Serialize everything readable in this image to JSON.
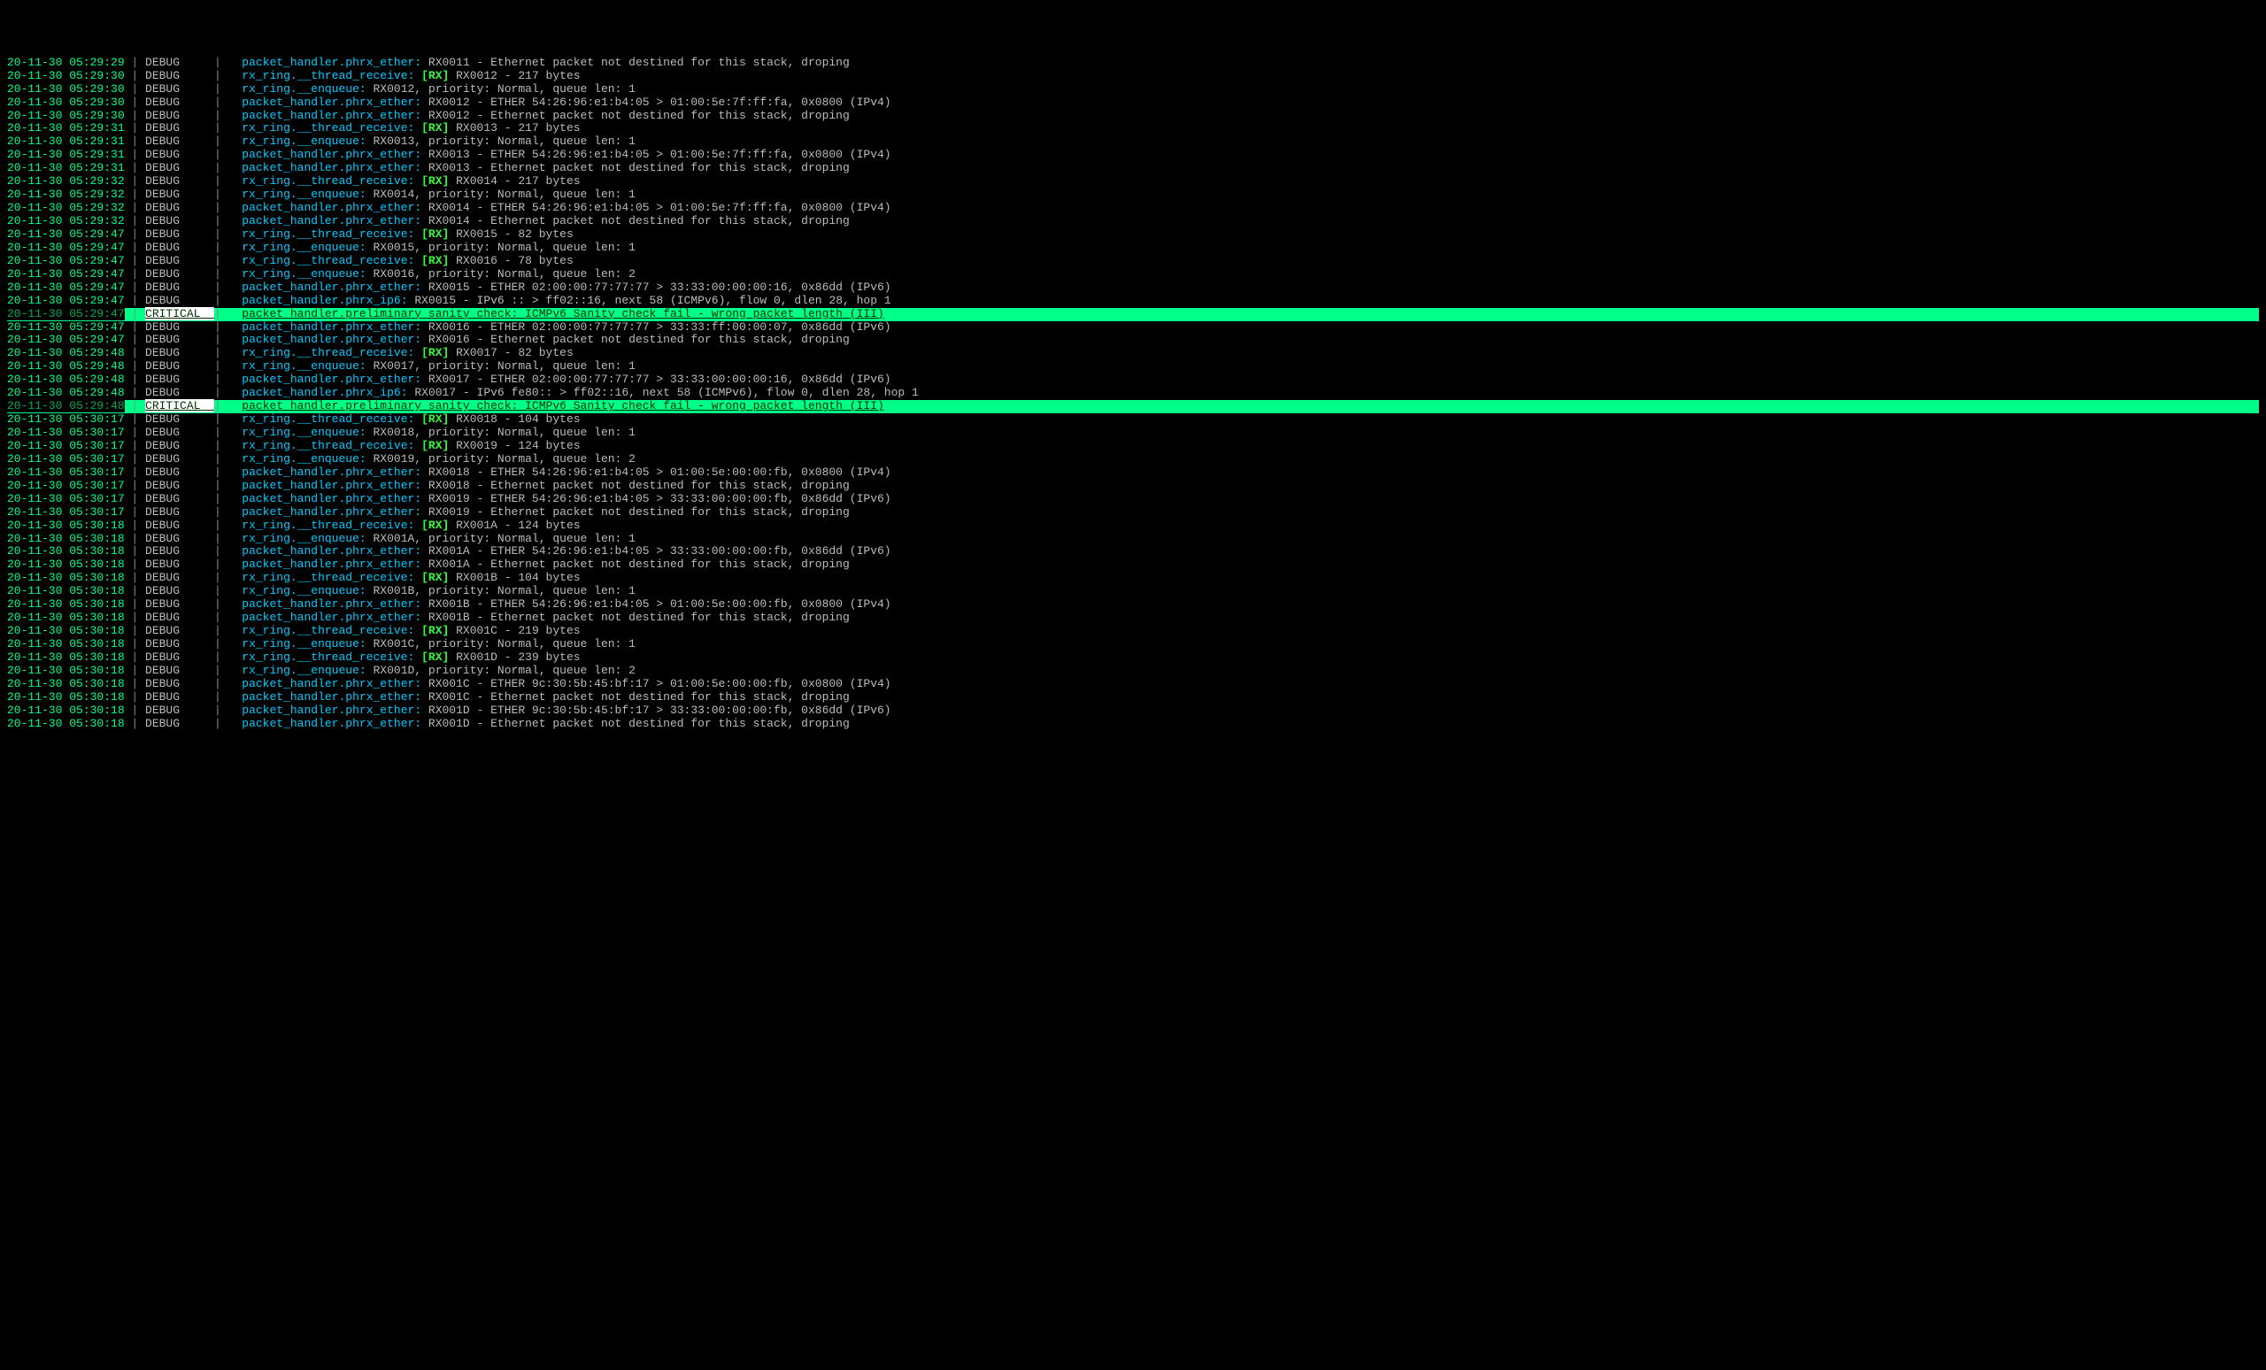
{
  "colors": {
    "timestamp": "#00ff88",
    "pipe": "#888888",
    "level_debug": "#bbbbbb",
    "logger": "#00ccff",
    "rx_tag": "#33ff33",
    "message": "#bbbbbb",
    "critical_bg": "#00ff88",
    "critical_fg": "#003300"
  },
  "columns": {
    "level_width_chars": 10
  },
  "log_lines": [
    {
      "ts": "20-11-30 05:29:29",
      "level": "DEBUG",
      "logger": "packet_handler.phrx_ether:",
      "msg": "RX0011 - Ethernet packet not destined for this stack, droping"
    },
    {
      "ts": "20-11-30 05:29:30",
      "level": "DEBUG",
      "logger": "rx_ring.__thread_receive:",
      "rx": "[RX]",
      "msg": " RX0012 - 217 bytes"
    },
    {
      "ts": "20-11-30 05:29:30",
      "level": "DEBUG",
      "logger": "rx_ring.__enqueue:",
      "msg": "RX0012, priority: Normal, queue len: 1"
    },
    {
      "ts": "20-11-30 05:29:30",
      "level": "DEBUG",
      "logger": "packet_handler.phrx_ether:",
      "msg": "RX0012 - ETHER 54:26:96:e1:b4:05 > 01:00:5e:7f:ff:fa, 0x0800 (IPv4)"
    },
    {
      "ts": "20-11-30 05:29:30",
      "level": "DEBUG",
      "logger": "packet_handler.phrx_ether:",
      "msg": "RX0012 - Ethernet packet not destined for this stack, droping"
    },
    {
      "ts": "20-11-30 05:29:31",
      "level": "DEBUG",
      "logger": "rx_ring.__thread_receive:",
      "rx": "[RX]",
      "msg": " RX0013 - 217 bytes"
    },
    {
      "ts": "20-11-30 05:29:31",
      "level": "DEBUG",
      "logger": "rx_ring.__enqueue:",
      "msg": "RX0013, priority: Normal, queue len: 1"
    },
    {
      "ts": "20-11-30 05:29:31",
      "level": "DEBUG",
      "logger": "packet_handler.phrx_ether:",
      "msg": "RX0013 - ETHER 54:26:96:e1:b4:05 > 01:00:5e:7f:ff:fa, 0x0800 (IPv4)"
    },
    {
      "ts": "20-11-30 05:29:31",
      "level": "DEBUG",
      "logger": "packet_handler.phrx_ether:",
      "msg": "RX0013 - Ethernet packet not destined for this stack, droping"
    },
    {
      "ts": "20-11-30 05:29:32",
      "level": "DEBUG",
      "logger": "rx_ring.__thread_receive:",
      "rx": "[RX]",
      "msg": " RX0014 - 217 bytes"
    },
    {
      "ts": "20-11-30 05:29:32",
      "level": "DEBUG",
      "logger": "rx_ring.__enqueue:",
      "msg": "RX0014, priority: Normal, queue len: 1"
    },
    {
      "ts": "20-11-30 05:29:32",
      "level": "DEBUG",
      "logger": "packet_handler.phrx_ether:",
      "msg": "RX0014 - ETHER 54:26:96:e1:b4:05 > 01:00:5e:7f:ff:fa, 0x0800 (IPv4)"
    },
    {
      "ts": "20-11-30 05:29:32",
      "level": "DEBUG",
      "logger": "packet_handler.phrx_ether:",
      "msg": "RX0014 - Ethernet packet not destined for this stack, droping"
    },
    {
      "ts": "20-11-30 05:29:47",
      "level": "DEBUG",
      "logger": "rx_ring.__thread_receive:",
      "rx": "[RX]",
      "msg": " RX0015 - 82 bytes"
    },
    {
      "ts": "20-11-30 05:29:47",
      "level": "DEBUG",
      "logger": "rx_ring.__enqueue:",
      "msg": "RX0015, priority: Normal, queue len: 1"
    },
    {
      "ts": "20-11-30 05:29:47",
      "level": "DEBUG",
      "logger": "rx_ring.__thread_receive:",
      "rx": "[RX]",
      "msg": " RX0016 - 78 bytes"
    },
    {
      "ts": "20-11-30 05:29:47",
      "level": "DEBUG",
      "logger": "rx_ring.__enqueue:",
      "msg": "RX0016, priority: Normal, queue len: 2"
    },
    {
      "ts": "20-11-30 05:29:47",
      "level": "DEBUG",
      "logger": "packet_handler.phrx_ether:",
      "msg": "RX0015 - ETHER 02:00:00:77:77:77 > 33:33:00:00:00:16, 0x86dd (IPv6)"
    },
    {
      "ts": "20-11-30 05:29:47",
      "level": "DEBUG",
      "logger": "packet_handler.phrx_ip6:",
      "msg": "RX0015 - IPv6 :: > ff02::16, next 58 (ICMPv6), flow 0, dlen 28, hop 1"
    },
    {
      "ts": "20-11-30 05:29:47",
      "level": "CRITICAL",
      "logger": "packet_handler.preliminary_sanity_check:",
      "msg": "ICMPv6 Sanity check fail - wrong packet length (III)",
      "critical": true
    },
    {
      "ts": "20-11-30 05:29:47",
      "level": "DEBUG",
      "logger": "packet_handler.phrx_ether:",
      "msg": "RX0016 - ETHER 02:00:00:77:77:77 > 33:33:ff:00:00:07, 0x86dd (IPv6)"
    },
    {
      "ts": "20-11-30 05:29:47",
      "level": "DEBUG",
      "logger": "packet_handler.phrx_ether:",
      "msg": "RX0016 - Ethernet packet not destined for this stack, droping"
    },
    {
      "ts": "20-11-30 05:29:48",
      "level": "DEBUG",
      "logger": "rx_ring.__thread_receive:",
      "rx": "[RX]",
      "msg": " RX0017 - 82 bytes"
    },
    {
      "ts": "20-11-30 05:29:48",
      "level": "DEBUG",
      "logger": "rx_ring.__enqueue:",
      "msg": "RX0017, priority: Normal, queue len: 1"
    },
    {
      "ts": "20-11-30 05:29:48",
      "level": "DEBUG",
      "logger": "packet_handler.phrx_ether:",
      "msg": "RX0017 - ETHER 02:00:00:77:77:77 > 33:33:00:00:00:16, 0x86dd (IPv6)"
    },
    {
      "ts": "20-11-30 05:29:48",
      "level": "DEBUG",
      "logger": "packet_handler.phrx_ip6:",
      "msg": "RX0017 - IPv6 fe80:: > ff02::16, next 58 (ICMPv6), flow 0, dlen 28, hop 1"
    },
    {
      "ts": "20-11-30 05:29:48",
      "level": "CRITICAL",
      "logger": "packet_handler.preliminary_sanity_check:",
      "msg": "ICMPv6 Sanity check fail - wrong packet length (III)",
      "critical": true
    },
    {
      "ts": "20-11-30 05:30:17",
      "level": "DEBUG",
      "logger": "rx_ring.__thread_receive:",
      "rx": "[RX]",
      "msg": " RX0018 - 104 bytes"
    },
    {
      "ts": "20-11-30 05:30:17",
      "level": "DEBUG",
      "logger": "rx_ring.__enqueue:",
      "msg": "RX0018, priority: Normal, queue len: 1"
    },
    {
      "ts": "20-11-30 05:30:17",
      "level": "DEBUG",
      "logger": "rx_ring.__thread_receive:",
      "rx": "[RX]",
      "msg": " RX0019 - 124 bytes"
    },
    {
      "ts": "20-11-30 05:30:17",
      "level": "DEBUG",
      "logger": "rx_ring.__enqueue:",
      "msg": "RX0019, priority: Normal, queue len: 2"
    },
    {
      "ts": "20-11-30 05:30:17",
      "level": "DEBUG",
      "logger": "packet_handler.phrx_ether:",
      "msg": "RX0018 - ETHER 54:26:96:e1:b4:05 > 01:00:5e:00:00:fb, 0x0800 (IPv4)"
    },
    {
      "ts": "20-11-30 05:30:17",
      "level": "DEBUG",
      "logger": "packet_handler.phrx_ether:",
      "msg": "RX0018 - Ethernet packet not destined for this stack, droping"
    },
    {
      "ts": "20-11-30 05:30:17",
      "level": "DEBUG",
      "logger": "packet_handler.phrx_ether:",
      "msg": "RX0019 - ETHER 54:26:96:e1:b4:05 > 33:33:00:00:00:fb, 0x86dd (IPv6)"
    },
    {
      "ts": "20-11-30 05:30:17",
      "level": "DEBUG",
      "logger": "packet_handler.phrx_ether:",
      "msg": "RX0019 - Ethernet packet not destined for this stack, droping"
    },
    {
      "ts": "20-11-30 05:30:18",
      "level": "DEBUG",
      "logger": "rx_ring.__thread_receive:",
      "rx": "[RX]",
      "msg": " RX001A - 124 bytes"
    },
    {
      "ts": "20-11-30 05:30:18",
      "level": "DEBUG",
      "logger": "rx_ring.__enqueue:",
      "msg": "RX001A, priority: Normal, queue len: 1"
    },
    {
      "ts": "20-11-30 05:30:18",
      "level": "DEBUG",
      "logger": "packet_handler.phrx_ether:",
      "msg": "RX001A - ETHER 54:26:96:e1:b4:05 > 33:33:00:00:00:fb, 0x86dd (IPv6)"
    },
    {
      "ts": "20-11-30 05:30:18",
      "level": "DEBUG",
      "logger": "packet_handler.phrx_ether:",
      "msg": "RX001A - Ethernet packet not destined for this stack, droping"
    },
    {
      "ts": "20-11-30 05:30:18",
      "level": "DEBUG",
      "logger": "rx_ring.__thread_receive:",
      "rx": "[RX]",
      "msg": " RX001B - 104 bytes"
    },
    {
      "ts": "20-11-30 05:30:18",
      "level": "DEBUG",
      "logger": "rx_ring.__enqueue:",
      "msg": "RX001B, priority: Normal, queue len: 1"
    },
    {
      "ts": "20-11-30 05:30:18",
      "level": "DEBUG",
      "logger": "packet_handler.phrx_ether:",
      "msg": "RX001B - ETHER 54:26:96:e1:b4:05 > 01:00:5e:00:00:fb, 0x0800 (IPv4)"
    },
    {
      "ts": "20-11-30 05:30:18",
      "level": "DEBUG",
      "logger": "packet_handler.phrx_ether:",
      "msg": "RX001B - Ethernet packet not destined for this stack, droping"
    },
    {
      "ts": "20-11-30 05:30:18",
      "level": "DEBUG",
      "logger": "rx_ring.__thread_receive:",
      "rx": "[RX]",
      "msg": " RX001C - 219 bytes"
    },
    {
      "ts": "20-11-30 05:30:18",
      "level": "DEBUG",
      "logger": "rx_ring.__enqueue:",
      "msg": "RX001C, priority: Normal, queue len: 1"
    },
    {
      "ts": "20-11-30 05:30:18",
      "level": "DEBUG",
      "logger": "rx_ring.__thread_receive:",
      "rx": "[RX]",
      "msg": " RX001D - 239 bytes"
    },
    {
      "ts": "20-11-30 05:30:18",
      "level": "DEBUG",
      "logger": "rx_ring.__enqueue:",
      "msg": "RX001D, priority: Normal, queue len: 2"
    },
    {
      "ts": "20-11-30 05:30:18",
      "level": "DEBUG",
      "logger": "packet_handler.phrx_ether:",
      "msg": "RX001C - ETHER 9c:30:5b:45:bf:17 > 01:00:5e:00:00:fb, 0x0800 (IPv4)"
    },
    {
      "ts": "20-11-30 05:30:18",
      "level": "DEBUG",
      "logger": "packet_handler.phrx_ether:",
      "msg": "RX001C - Ethernet packet not destined for this stack, droping"
    },
    {
      "ts": "20-11-30 05:30:18",
      "level": "DEBUG",
      "logger": "packet_handler.phrx_ether:",
      "msg": "RX001D - ETHER 9c:30:5b:45:bf:17 > 33:33:00:00:00:fb, 0x86dd (IPv6)"
    },
    {
      "ts": "20-11-30 05:30:18",
      "level": "DEBUG",
      "logger": "packet_handler.phrx_ether:",
      "msg": "RX001D - Ethernet packet not destined for this stack, droping"
    }
  ]
}
